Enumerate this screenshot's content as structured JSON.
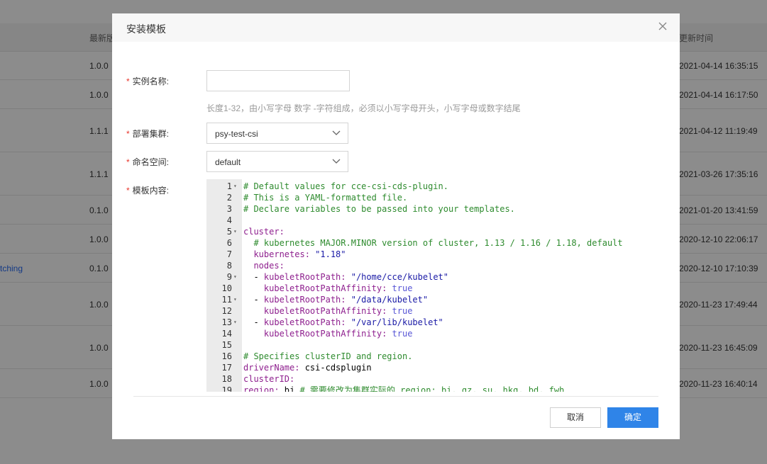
{
  "background_table": {
    "header": {
      "version_col": "最新版",
      "time_col": "更新时间"
    },
    "rows": [
      {
        "version": "1.0.0",
        "time": "2021-04-14 16:35:15"
      },
      {
        "version": "1.0.0",
        "time": "2021-04-14 16:17:50"
      },
      {
        "version": "1.1.1",
        "time": "2021-04-12 11:19:49"
      },
      {
        "version": "1.1.1",
        "time": "2021-03-26 17:35:16"
      },
      {
        "version": "0.1.0",
        "time": "2021-01-20 13:41:59"
      },
      {
        "version": "1.0.0",
        "time": "2020-12-10 22:06:17"
      },
      {
        "version": "0.1.0",
        "time": "2020-12-10 17:10:39",
        "link": "tching"
      },
      {
        "version": "1.0.0",
        "time": "2020-11-23 17:49:44"
      },
      {
        "version": "1.0.0",
        "time": "2020-11-23 16:45:09"
      },
      {
        "version": "1.0.0",
        "time": "2020-11-23 16:40:14"
      }
    ]
  },
  "modal": {
    "title": "安装模板",
    "close_icon": "close-icon",
    "fields": {
      "instance_name": {
        "label": "实例名称:",
        "value": "",
        "placeholder": "",
        "hint": "长度1-32，由小写字母 数字 -字符组成，必须以小写字母开头，小写字母或数字结尾"
      },
      "cluster": {
        "label": "部署集群:",
        "value": "psy-test-csi"
      },
      "namespace": {
        "label": "命名空间:",
        "value": "default"
      },
      "template": {
        "label": "模板内容:"
      }
    },
    "required_mark": "*",
    "editor_lines": [
      {
        "n": "1",
        "fold": true,
        "text": "# Default values for cce-csi-cds-plugin."
      },
      {
        "n": "2",
        "text": "# This is a YAML-formatted file."
      },
      {
        "n": "3",
        "text": "# Declare variables to be passed into your templates."
      },
      {
        "n": "4",
        "text": ""
      },
      {
        "n": "5",
        "fold": true,
        "key": "cluster:",
        "text": ""
      },
      {
        "n": "6",
        "text": "  # kubernetes MAJOR.MINOR version of cluster, 1.13 / 1.16 / 1.18, default"
      },
      {
        "n": "7",
        "key": "  kubernetes:",
        "str": " \"1.18\""
      },
      {
        "n": "8",
        "key": "  nodes:"
      },
      {
        "n": "9",
        "fold": true,
        "plain": "  - ",
        "key": "kubeletRootPath:",
        "str": " \"/home/cce/kubelet\""
      },
      {
        "n": "10",
        "key": "    kubeletRootPathAffinity:",
        "bool": " true"
      },
      {
        "n": "11",
        "fold": true,
        "plain": "  - ",
        "key": "kubeletRootPath:",
        "str": " \"/data/kubelet\""
      },
      {
        "n": "12",
        "key": "    kubeletRootPathAffinity:",
        "bool": " true"
      },
      {
        "n": "13",
        "fold": true,
        "plain": "  - ",
        "key": "kubeletRootPath:",
        "str": " \"/var/lib/kubelet\""
      },
      {
        "n": "14",
        "key": "    kubeletRootPathAffinity:",
        "bool": " true"
      },
      {
        "n": "15",
        "text": ""
      },
      {
        "n": "16",
        "text": "# Specifies clusterID and region."
      },
      {
        "n": "17",
        "key": "driverName:",
        "plain2": " csi-cdsplugin"
      },
      {
        "n": "18",
        "key": "clusterID:"
      },
      {
        "n": "19",
        "key": "region:",
        "plain2": " bj ",
        "comment": "# 需要修改为集群实际的 region: bj, gz, su, hkg, bd, fwh"
      }
    ],
    "buttons": {
      "cancel": "取消",
      "ok": "确定"
    }
  }
}
